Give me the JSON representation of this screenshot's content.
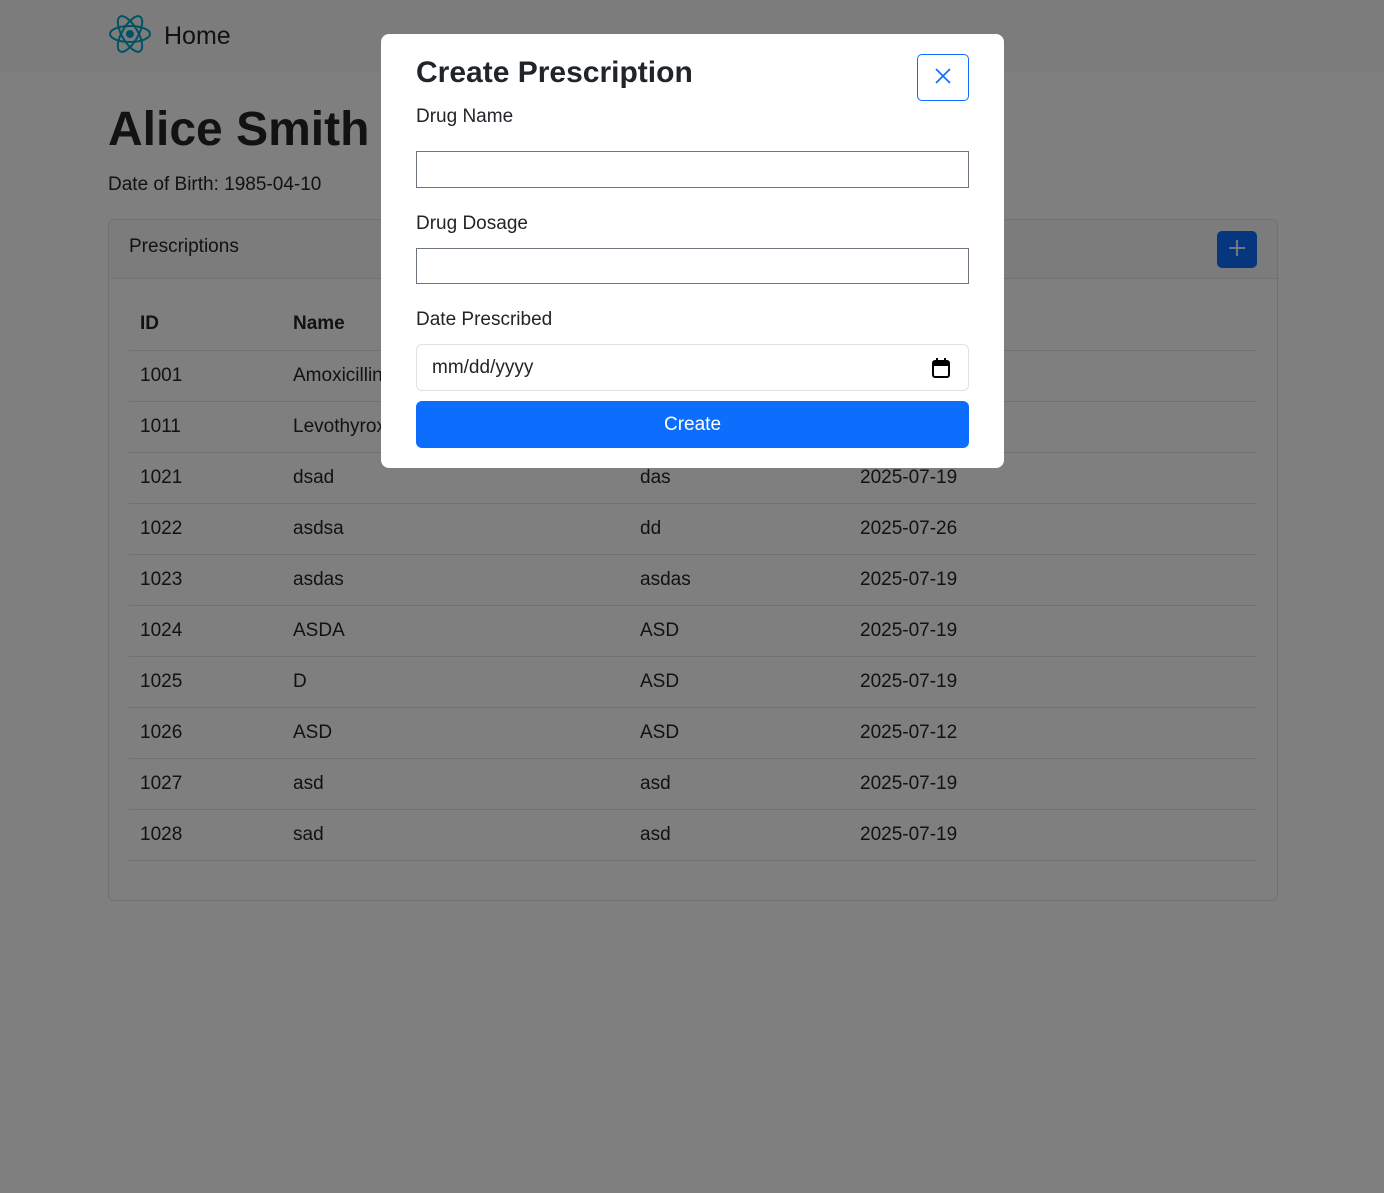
{
  "navbar": {
    "brand_label": "Home",
    "brand_icon": "react-logo-icon"
  },
  "patient": {
    "name": "Alice Smith",
    "dob_text": "Date of Birth: 1985-04-10"
  },
  "prescriptions": {
    "title": "Prescriptions",
    "add_icon": "plus-icon",
    "columns": [
      "ID",
      "Name",
      "",
      ""
    ],
    "rows": [
      {
        "id": "1001",
        "name": "Amoxicillin",
        "dosage": "",
        "date": ""
      },
      {
        "id": "1011",
        "name": "Levothyroxine",
        "dosage": "",
        "date": ""
      },
      {
        "id": "1021",
        "name": "dsad",
        "dosage": "das",
        "date": "2025-07-19"
      },
      {
        "id": "1022",
        "name": "asdsa",
        "dosage": "dd",
        "date": "2025-07-26"
      },
      {
        "id": "1023",
        "name": "asdas",
        "dosage": "asdas",
        "date": "2025-07-19"
      },
      {
        "id": "1024",
        "name": "ASDA",
        "dosage": "ASD",
        "date": "2025-07-19"
      },
      {
        "id": "1025",
        "name": "D",
        "dosage": "ASD",
        "date": "2025-07-19"
      },
      {
        "id": "1026",
        "name": "ASD",
        "dosage": "ASD",
        "date": "2025-07-12"
      },
      {
        "id": "1027",
        "name": "asd",
        "dosage": "asd",
        "date": "2025-07-19"
      },
      {
        "id": "1028",
        "name": "sad",
        "dosage": "asd",
        "date": "2025-07-19"
      }
    ]
  },
  "modal": {
    "title": "Create Prescription",
    "close_icon": "close-icon",
    "drug_name_label": "Drug Name",
    "drug_name_value": "",
    "drug_dosage_label": "Drug Dosage",
    "drug_dosage_value": "",
    "date_label": "Date Prescribed",
    "date_placeholder": "mm/dd/yyyy",
    "calendar_icon": "calendar-icon",
    "create_label": "Create"
  },
  "colors": {
    "primary": "#0d6efd",
    "backdrop": "rgba(0,0,0,0.5)",
    "react_blue": "#00a6c8"
  }
}
